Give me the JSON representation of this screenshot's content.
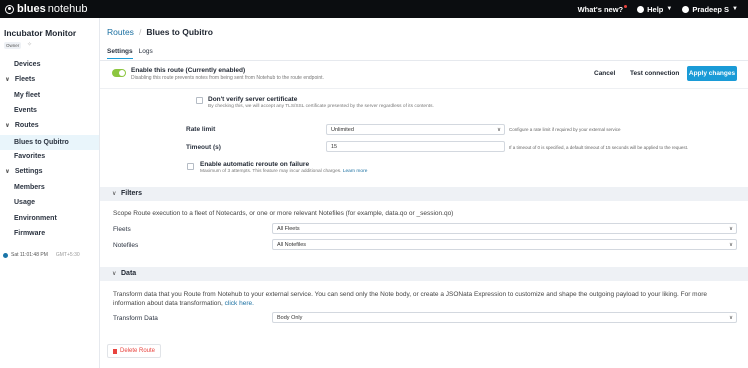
{
  "topbar": {
    "brand_blues": "blues",
    "brand_notehub": "notehub",
    "whats_new": "What's new?",
    "help": "Help",
    "user": "Pradeep S"
  },
  "sidebar": {
    "project_title": "Incubator Monitor",
    "owner_badge": "Owner",
    "items": [
      {
        "label": "Devices"
      },
      {
        "label": "Fleets"
      },
      {
        "label": "My fleet"
      },
      {
        "label": "Events"
      },
      {
        "label": "Routes"
      },
      {
        "label": "Blues to Qubitro"
      },
      {
        "label": "Favorites"
      },
      {
        "label": "Settings"
      },
      {
        "label": "Members"
      },
      {
        "label": "Usage"
      },
      {
        "label": "Environment"
      },
      {
        "label": "Firmware"
      }
    ],
    "time": "Sat 11:01:48 PM",
    "gmt": "GMT+5:30"
  },
  "breadcrumb": {
    "routes": "Routes",
    "separator": "/",
    "current": "Blues to Qubitro"
  },
  "tabs": [
    {
      "label": "Settings"
    },
    {
      "label": "Logs"
    }
  ],
  "enable": {
    "title": "Enable this route (Currently enabled)",
    "subtitle": "Disabling this route prevents notes from being sent from Notehub to the route endpoint.",
    "cancel": "Cancel",
    "test": "Test connection",
    "apply": "Apply changes"
  },
  "cert": {
    "title": "Don't verify server certificate",
    "subtitle": "By checking this, we will accept any TLS/SSL certificate presented by the server regardless of its contents."
  },
  "rate_limit": {
    "label": "Rate limit",
    "value": "Unlimited",
    "hint": "Configure a rate limit if required by your external service"
  },
  "timeout": {
    "label": "Timeout (s)",
    "value": "15",
    "hint": "If a timeout of 0 is specified, a default timeout of 15 seconds will be applied to the request."
  },
  "reroute": {
    "title": "Enable automatic reroute on failure",
    "subtitle": "Maximum of 3 attempts. This feature may incur additional charges.",
    "link": "Learn more"
  },
  "filters": {
    "title": "Filters",
    "description": "Scope Route execution to a fleet of Notecards, or one or more relevant Notefiles (for example, data.qo or _session.qo)",
    "fleets_label": "Fleets",
    "fleets_value": "All Fleets",
    "notefiles_label": "Notefiles",
    "notefiles_value": "All Notefiles"
  },
  "data": {
    "title": "Data",
    "description": "Transform data that you Route from Notehub to your external service. You can send only the Note body, or create a JSONata Expression to customize and shape the outgoing payload to your liking. For more information about data transformation,",
    "link": "click here.",
    "transform_label": "Transform Data",
    "transform_value": "Body Only"
  },
  "delete_button": "Delete Route"
}
